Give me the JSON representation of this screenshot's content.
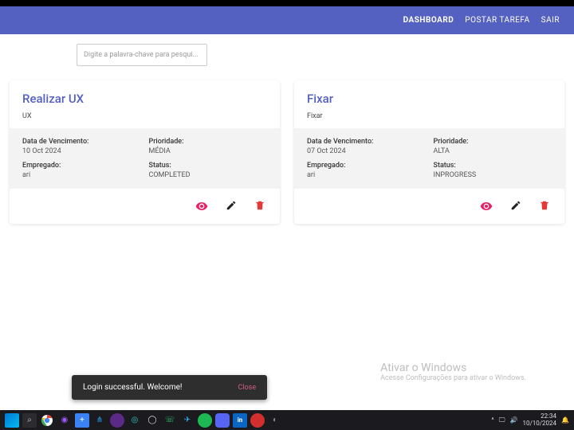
{
  "nav": {
    "dashboard": "DASHBOARD",
    "post_task": "POSTAR TAREFA",
    "logout": "SAIR"
  },
  "search": {
    "placeholder": "Digite a palavra-chave para pesqui..."
  },
  "cards": [
    {
      "title": "Realizar UX",
      "subtitle": "UX",
      "due_label": "Data de Vencimento:",
      "due_value": "10 Oct 2024",
      "priority_label": "Prioridade:",
      "priority_value": "MÉDIA",
      "employee_label": "Empregado:",
      "employee_value": "ari",
      "status_label": "Status:",
      "status_value": "COMPLETED"
    },
    {
      "title": "Fixar",
      "subtitle": "Fixar",
      "due_label": "Data de Vencimento:",
      "due_value": "07 Oct 2024",
      "priority_label": "Prioridade:",
      "priority_value": "ALTA",
      "employee_label": "Empregado:",
      "employee_value": "ari",
      "status_label": "Status:",
      "status_value": "INPROGRESS"
    }
  ],
  "toast": {
    "message": "Login successful. Welcome!",
    "close": "Close"
  },
  "watermark": {
    "title": "Ativar o Windows",
    "subtitle": "Acesse Configurações para ativar o Windows."
  },
  "taskbar": {
    "time": "22:34",
    "date": "10/10/2024"
  }
}
